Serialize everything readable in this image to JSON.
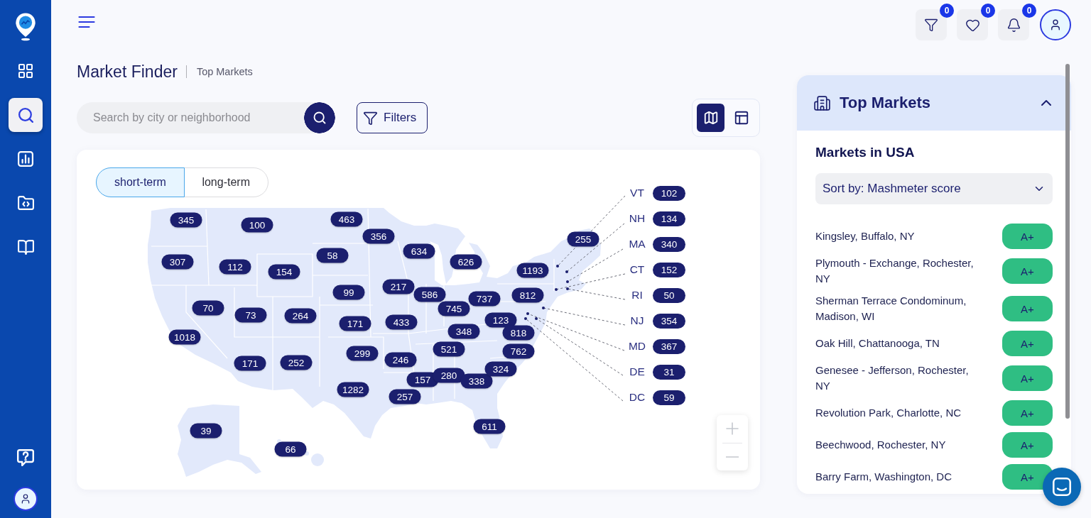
{
  "sidebar": {
    "nav": [
      {
        "kind": "dashboard",
        "selected": false
      },
      {
        "kind": "search",
        "selected": true
      },
      {
        "kind": "analytics",
        "selected": false
      },
      {
        "kind": "projects",
        "selected": false
      },
      {
        "kind": "guide",
        "selected": false
      }
    ]
  },
  "header": {
    "actions": [
      {
        "kind": "filters",
        "count": "0"
      },
      {
        "kind": "favorites",
        "count": "0"
      },
      {
        "kind": "notifications",
        "count": "0"
      }
    ]
  },
  "page": {
    "title": "Market Finder",
    "breadcrumb": "Top Markets"
  },
  "search": {
    "placeholder": "Search by city or neighborhood"
  },
  "filters_button": {
    "label": "Filters"
  },
  "view_modes": [
    {
      "kind": "map",
      "selected": true
    },
    {
      "kind": "table",
      "selected": false
    }
  ],
  "map": {
    "tabs": [
      {
        "label": "short-term",
        "selected": true
      },
      {
        "label": "long-term",
        "selected": false
      }
    ],
    "counts": [
      "345",
      "100",
      "463",
      "356",
      "255",
      "307",
      "112",
      "154",
      "58",
      "634",
      "626",
      "1193",
      "70",
      "73",
      "264",
      "99",
      "171",
      "217",
      "433",
      "586",
      "745",
      "737",
      "123",
      "812",
      "1018",
      "348",
      "818",
      "171",
      "252",
      "1282",
      "299",
      "246",
      "257",
      "157",
      "280",
      "521",
      "338",
      "324",
      "762",
      "39",
      "611",
      "66"
    ],
    "legend": [
      {
        "state": "VT",
        "count": "102"
      },
      {
        "state": "NH",
        "count": "134"
      },
      {
        "state": "MA",
        "count": "340"
      },
      {
        "state": "CT",
        "count": "152"
      },
      {
        "state": "RI",
        "count": "50"
      },
      {
        "state": "NJ",
        "count": "354"
      },
      {
        "state": "MD",
        "count": "367"
      },
      {
        "state": "DE",
        "count": "31"
      },
      {
        "state": "DC",
        "count": "59"
      }
    ]
  },
  "top_markets": {
    "title": "Top Markets",
    "expanded": true,
    "subtitle": "Markets in USA",
    "sort": "Sort by: Mashmeter score",
    "rows": [
      {
        "name": "Kingsley, Buffalo, NY",
        "grade": "A+"
      },
      {
        "name": "Plymouth - Exchange, Rochester, NY",
        "grade": "A+"
      },
      {
        "name": "Sherman Terrace Condominum, Madison, WI",
        "grade": "A+"
      },
      {
        "name": "Oak Hill, Chattanooga, TN",
        "grade": "A+"
      },
      {
        "name": "Genesee - Jefferson, Rochester, NY",
        "grade": "A+"
      },
      {
        "name": "Revolution Park, Charlotte, NC",
        "grade": "A+"
      },
      {
        "name": "Beechwood, Rochester, NY",
        "grade": "A+"
      },
      {
        "name": "Barry Farm, Washington, DC",
        "grade": "A+"
      }
    ]
  }
}
